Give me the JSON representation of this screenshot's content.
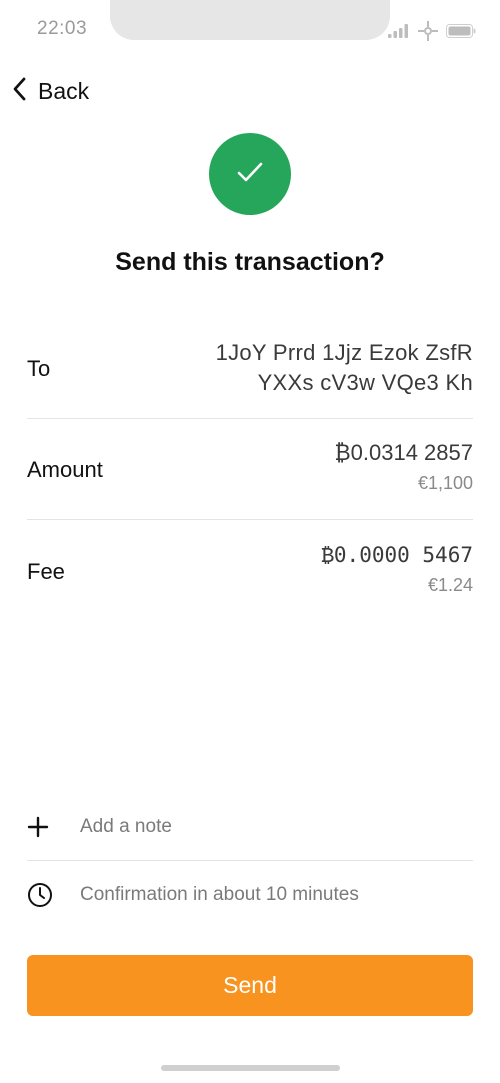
{
  "status_bar": {
    "time": "22:03",
    "icons": [
      "signal-icon",
      "network-icon",
      "battery-icon"
    ]
  },
  "nav": {
    "back_label": "Back"
  },
  "header": {
    "status_icon": "checkmark-icon",
    "title": "Send this transaction?"
  },
  "details": {
    "to": {
      "label": "To",
      "address_line1": "1JoY Prrd 1Jjz Ezok ZsfR",
      "address_line2": "YXXs cV3w VQe3 Kh"
    },
    "amount": {
      "label": "Amount",
      "btc": "₿0.0314 2857",
      "fiat": "€1,100"
    },
    "fee": {
      "label": "Fee",
      "btc": "₿0.0000 5467",
      "fiat": "€1.24"
    }
  },
  "options": {
    "add_note": "Add a note",
    "add_note_icon": "plus-icon",
    "confirmation": "Confirmation in about 10 minutes",
    "confirmation_icon": "clock-icon"
  },
  "actions": {
    "send_label": "Send"
  },
  "colors": {
    "accent": "#f7931e",
    "success": "#26a65b",
    "divider": "#e4e4e4"
  }
}
